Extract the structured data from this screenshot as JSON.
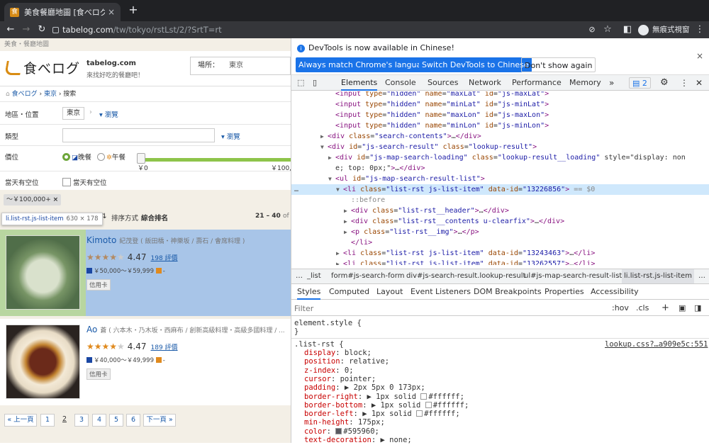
{
  "browser": {
    "tab_title": "美食餐廳地圖 [食べログ]",
    "tab_close": "×",
    "new_tab": "+",
    "url_host": "tabelog.com",
    "url_path": "/tw/tokyo/rstLst/2/?SrtT=rt",
    "profile_label": "無痕式視窗",
    "icons": [
      "back-icon",
      "forward-icon",
      "reload-icon",
      "lock-icon",
      "eye-off-icon",
      "star-icon",
      "sidebar-icon",
      "incognito-icon",
      "kebab-icon"
    ]
  },
  "page": {
    "top_crumb": "美食・餐廳地圖",
    "logo_text": "食べログ",
    "site_name": "tabelog.com",
    "tagline": "來找好吃的餐廳吧！",
    "location_label": "場所：",
    "location_value": "東京",
    "breadcrumb": [
      "食べログ",
      "東京",
      "搜索"
    ],
    "filters": {
      "area_label": "地區・位置",
      "area_value": "東京",
      "area_browse": "瀏覽",
      "genre_label": "類型",
      "genre_browse": "瀏覽",
      "price_label": "價位",
      "dinner": "晚餐",
      "lunch": "午餐",
      "min_price": "￥0",
      "max_price": "￥100,0",
      "today_label": "當天有空位",
      "today_check": "當天有空位"
    },
    "chip": "～￥100,000+",
    "chip_close": "×",
    "sort_label": "排序方式",
    "sort_value": "綜合排名",
    "range": "21 – 40",
    "range_of": "of 13",
    "tooltip_selector": "li.list-rst.js-list-item",
    "tooltip_dims": "630 × 178",
    "restaurants": [
      {
        "name": "Kimoto",
        "sub": "紀茂登 ( 飯田橋・神樂坂 / 壽石 / 會席料理 )",
        "score": "4.47",
        "reviews": "198 評價",
        "price": "￥50,000～￥59,999",
        "price_extra": "-",
        "card": "信用卡",
        "rating": 4.47
      },
      {
        "name": "Ao",
        "sub": "蒼 ( 六本木・乃木坂・西麻布 / 創新高級料理・高級多國料理 / ...",
        "score": "4.47",
        "reviews": "189 評價",
        "price": "￥40,000～￥49,999",
        "price_extra": "-",
        "card": "信用卡",
        "rating": 4.47
      }
    ],
    "pager": {
      "prev": "« 上一頁",
      "pages": [
        "1",
        "2",
        "3",
        "4",
        "5",
        "6"
      ],
      "current": "2",
      "next": "下一頁 »"
    }
  },
  "devtools": {
    "banner_msg": "DevTools is now available in Chinese!",
    "btn_match": "Always match Chrome's language",
    "btn_switch": "Switch DevTools to Chinese",
    "btn_dont": "Don't show again",
    "banner_close": "×",
    "tabs": [
      "Elements",
      "Console",
      "Sources",
      "Network",
      "Performance",
      "Memory"
    ],
    "more_tabs": "»",
    "issues_count": "2",
    "dom_lines": [
      {
        "indent": 0,
        "html": "<input type=\"hidden\" name=\"maxLat\" id=\"js-maxLat\">",
        "tri": ""
      },
      {
        "indent": 0,
        "html": "<input type=\"hidden\" name=\"minLat\" id=\"js-minLat\">",
        "tri": ""
      },
      {
        "indent": 0,
        "html": "<input type=\"hidden\" name=\"maxLon\" id=\"js-maxLon\">",
        "tri": ""
      },
      {
        "indent": 0,
        "html": "<input type=\"hidden\" name=\"minLon\" id=\"js-minLon\">",
        "tri": ""
      },
      {
        "indent": -1,
        "html": "<div class=\"search-contents\">…</div>",
        "tri": "▶"
      },
      {
        "indent": -1,
        "html": "<div id=\"js-search-result\" class=\"lookup-result\">",
        "tri": "▼"
      },
      {
        "indent": 0,
        "html": "<div id=\"js-map-search-loading\" class=\"lookup-result__loading\" style=\"display: non",
        "tri": "▶"
      },
      {
        "indent": 0,
        "html": "e; top: 0px;\">…</div>",
        "tri": ""
      },
      {
        "indent": 0,
        "html": "<ul id=\"js-map-search-result-list\">",
        "tri": "▼"
      },
      {
        "indent": 1,
        "html": "<li class=\"list-rst js-list-item\" data-id=\"13226856\"> == $0",
        "tri": "▼"
      },
      {
        "indent": 2,
        "html": "::before",
        "tri": ""
      },
      {
        "indent": 2,
        "html": "<div class=\"list-rst__header\">…</div>",
        "tri": "▶"
      },
      {
        "indent": 2,
        "html": "<div class=\"list-rst__contents u-clearfix\">…</div>",
        "tri": "▶"
      },
      {
        "indent": 2,
        "html": "<p class=\"list-rst__img\">…</p>",
        "tri": "▶"
      },
      {
        "indent": 2,
        "html": "</li>",
        "tri": ""
      },
      {
        "indent": 1,
        "html": "<li class=\"list-rst js-list-item\" data-id=\"13243463\">…</li>",
        "tri": "▶"
      },
      {
        "indent": 1,
        "html": "<li class=\"list-rst js-list-item\" data-id=\"13262557\">…</li>",
        "tri": "▶"
      }
    ],
    "dom_crumbs": [
      "…",
      "_list",
      "form#js-search-form",
      "div#js-search-result.lookup-result",
      "ul#js-map-search-result-list",
      "li.list-rst.js-list-item",
      "…"
    ],
    "style_tabs": [
      "Styles",
      "Computed",
      "Layout",
      "Event Listeners",
      "DOM Breakpoints",
      "Properties",
      "Accessibility"
    ],
    "filter_placeholder": "Filter",
    "hov": ":hov",
    "cls": ".cls",
    "plus": "+",
    "element_style_open": "element.style {",
    "element_style_close": "}",
    "rule_selector": ".list-rst {",
    "rule_source": "lookup.css?…a909e5c:551",
    "props": [
      {
        "n": "display",
        "v": "block;"
      },
      {
        "n": "position",
        "v": "relative;"
      },
      {
        "n": "z-index",
        "v": "0;"
      },
      {
        "n": "cursor",
        "v": "pointer;"
      },
      {
        "n": "padding",
        "v": "▶ 2px 5px 0 173px;"
      },
      {
        "n": "border-right",
        "v": "▶ 1px solid #ffffff;"
      },
      {
        "n": "border-bottom",
        "v": "▶ 1px solid #ffffff;"
      },
      {
        "n": "border-left",
        "v": "▶ 1px solid #ffffff;"
      },
      {
        "n": "min-height",
        "v": "175px;"
      },
      {
        "n": "color",
        "v": "#595960;"
      },
      {
        "n": "text-decoration",
        "v": "▶ none;"
      }
    ]
  }
}
